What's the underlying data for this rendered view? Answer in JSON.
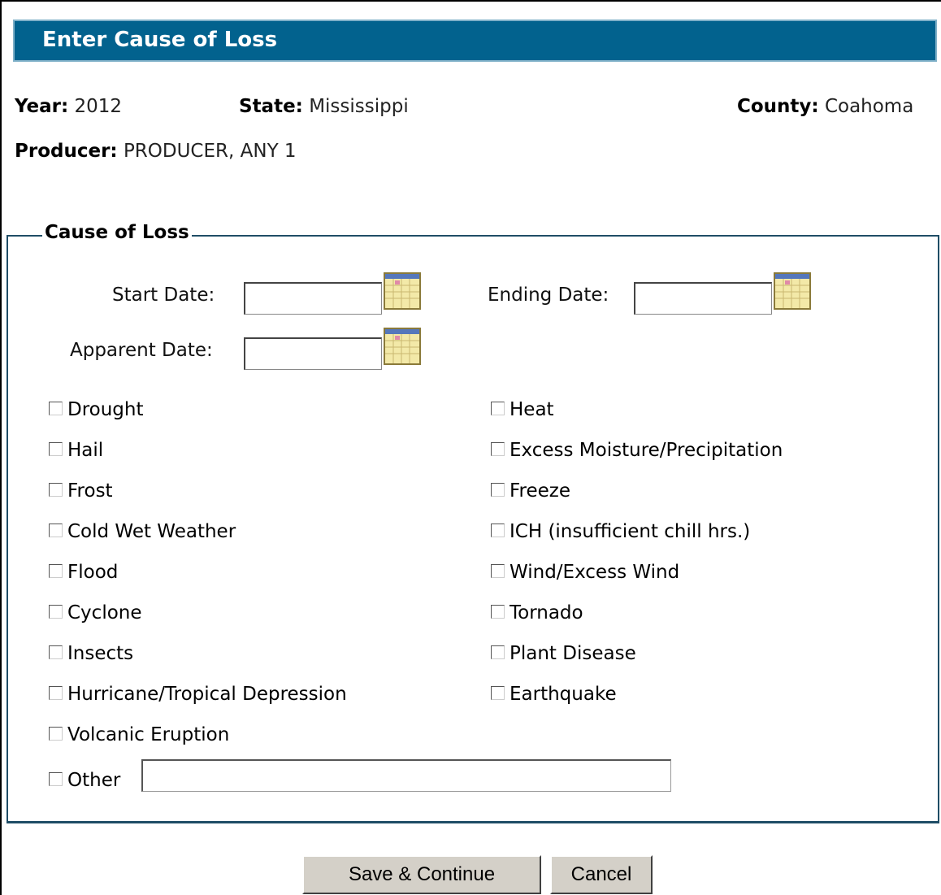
{
  "header": {
    "title": "Enter Cause of Loss"
  },
  "info": {
    "year_label": "Year:",
    "year": "2012",
    "state_label": "State:",
    "state": "Mississippi",
    "county_label": "County:",
    "county": "Coahoma",
    "producer_label": "Producer:",
    "producer": "PRODUCER, ANY 1"
  },
  "cause_of_loss": {
    "legend": "Cause of Loss",
    "start_date_label": "Start Date:",
    "ending_date_label": "Ending Date:",
    "apparent_date_label": "Apparent Date:",
    "left_causes": [
      "Drought",
      "Hail",
      "Frost",
      "Cold Wet Weather",
      "Flood",
      "Cyclone",
      "Insects",
      "Hurricane/Tropical Depression",
      "Volcanic Eruption",
      "Other"
    ],
    "right_causes": [
      "Heat",
      "Excess Moisture/Precipitation",
      "Freeze",
      "ICH (insufficient chill hrs.)",
      "Wind/Excess Wind",
      "Tornado",
      "Plant Disease",
      "Earthquake"
    ]
  },
  "actions": {
    "save_label": "Save & Continue",
    "cancel_label": "Cancel"
  },
  "colors": {
    "title_bar": "#02628e",
    "fieldset_border": "#1f4d66",
    "button_face": "#d4d0c8"
  },
  "icons": {
    "calendar": "calendar-icon"
  }
}
